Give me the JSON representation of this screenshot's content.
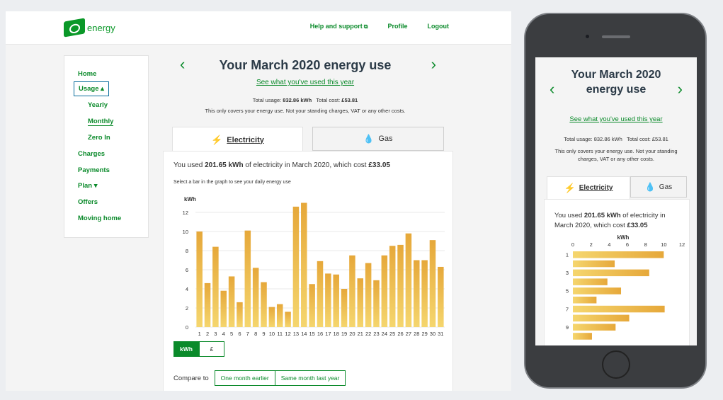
{
  "nav": {
    "logo_text": "energy",
    "links": [
      "Help and support",
      "Profile",
      "Logout"
    ]
  },
  "sidebar": {
    "items": [
      {
        "label": "Home"
      },
      {
        "label": "Usage ▴"
      },
      {
        "label": "Yearly"
      },
      {
        "label": "Monthly"
      },
      {
        "label": "Zero In"
      },
      {
        "label": "Charges"
      },
      {
        "label": "Payments"
      },
      {
        "label": "Plan ▾"
      },
      {
        "label": "Offers"
      },
      {
        "label": "Moving home"
      }
    ]
  },
  "main": {
    "title": "Your March 2020 energy use",
    "see_link": "See what you've used this year",
    "total_usage_label": "Total usage:",
    "total_usage_value": "832.86 kWh",
    "total_cost_label": "Total cost:",
    "total_cost_value": "£53.81",
    "disclaimer": "This only covers your energy use. Not your standing charges, VAT or any other costs.",
    "tabs": [
      {
        "label": "Electricity"
      },
      {
        "label": "Gas"
      }
    ],
    "used_prefix": "You used ",
    "used_amount": "201.65 kWh",
    "used_middle": " of electricity in March 2020, which cost ",
    "used_cost": "£33.05",
    "hint": "Select a bar in the graph to see your daily energy use",
    "unit_toggle": [
      "kWh",
      "£"
    ],
    "compare_label": "Compare to",
    "compare_options": [
      "One month earlier",
      "Same month last year"
    ]
  },
  "phone": {
    "title": "Your March 2020 energy use",
    "see_link": "See what you've used this year",
    "total_usage": "Total usage: 832.86 kWh",
    "total_cost": "Total cost: £53.81",
    "disclaimer": "This only covers your energy use. Not your standing charges, VAT or any other costs."
  },
  "colors": {
    "brand_green": "#0a8a2a",
    "bar_top": "#e6a83a",
    "bar_bottom": "#f5d66e"
  },
  "chart_data": [
    {
      "type": "bar",
      "ylabel": "kWh",
      "ylim": [
        0,
        12
      ],
      "yticks": [
        0,
        2,
        4,
        6,
        8,
        10,
        12
      ],
      "categories": [
        "1",
        "2",
        "3",
        "4",
        "5",
        "6",
        "7",
        "8",
        "9",
        "10",
        "11",
        "12",
        "13",
        "14",
        "15",
        "16",
        "17",
        "18",
        "19",
        "20",
        "21",
        "22",
        "23",
        "24",
        "25",
        "26",
        "27",
        "28",
        "29",
        "30",
        "31"
      ],
      "values": [
        10.0,
        4.6,
        8.4,
        3.8,
        5.3,
        2.6,
        10.1,
        6.2,
        4.7,
        2.1,
        2.4,
        1.6,
        12.6,
        13.0,
        4.5,
        6.9,
        5.6,
        5.5,
        4.0,
        7.5,
        5.1,
        6.7,
        4.9,
        7.5,
        8.5,
        8.6,
        9.8,
        7.0,
        7.0,
        9.1,
        6.3
      ],
      "grid": true
    },
    {
      "type": "bar",
      "orientation": "horizontal",
      "xlabel": "kWh",
      "xlim": [
        0,
        12
      ],
      "xticks": [
        0,
        2,
        4,
        6,
        8,
        10,
        12
      ],
      "categories": [
        "1",
        "2",
        "3",
        "4",
        "5",
        "6",
        "7",
        "8",
        "9",
        "10"
      ],
      "category_labels_shown": [
        "1",
        "3",
        "5",
        "7",
        "9"
      ],
      "values": [
        10.0,
        4.6,
        8.4,
        3.8,
        5.3,
        2.6,
        10.1,
        6.2,
        4.7,
        2.1
      ]
    }
  ]
}
